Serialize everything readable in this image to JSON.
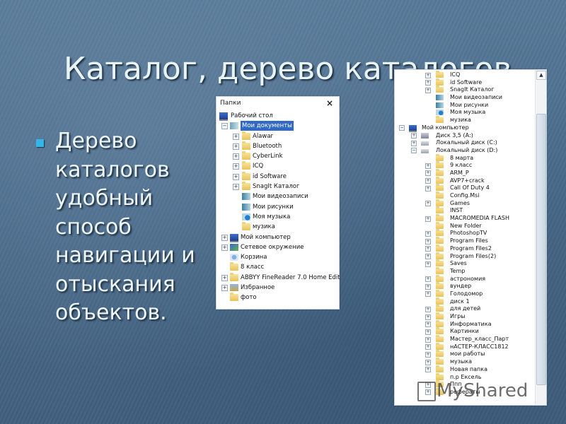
{
  "slide": {
    "title": "Каталог, дерево каталогов",
    "bullet_lines": [
      "Дерево",
      "каталогов",
      "удобный",
      "способ",
      "навигации и",
      "отыскания",
      "объектов."
    ],
    "bullet_color": "#33b5e5"
  },
  "folders_panel": {
    "header": "Папки",
    "close_icon": "×",
    "items": [
      {
        "label": "Рабочий стол",
        "level": 0,
        "expander": "",
        "icon": "monitor-icon"
      },
      {
        "label": "Мои документы",
        "level": 1,
        "expander": "−",
        "icon": "documents-icon",
        "selected": true
      },
      {
        "label": "Alawar",
        "level": 2,
        "expander": "+",
        "icon": "folder-icon"
      },
      {
        "label": "Bluetooth",
        "level": 2,
        "expander": "+",
        "icon": "folder-icon"
      },
      {
        "label": "CyberLink",
        "level": 2,
        "expander": "+",
        "icon": "folder-icon"
      },
      {
        "label": "ICQ",
        "level": 2,
        "expander": "+",
        "icon": "folder-icon"
      },
      {
        "label": "id Software",
        "level": 2,
        "expander": "+",
        "icon": "folder-icon"
      },
      {
        "label": "SnagIt Каталог",
        "level": 2,
        "expander": "+",
        "icon": "folder-icon"
      },
      {
        "label": "Мои видеозаписи",
        "level": 2,
        "expander": "",
        "icon": "videos-icon"
      },
      {
        "label": "Мои рисунки",
        "level": 2,
        "expander": "",
        "icon": "pictures-icon"
      },
      {
        "label": "Моя музыка",
        "level": 2,
        "expander": "",
        "icon": "music-icon"
      },
      {
        "label": "музика",
        "level": 2,
        "expander": "",
        "icon": "folder-icon"
      },
      {
        "label": "Мой компьютер",
        "level": 1,
        "expander": "+",
        "icon": "computer-icon"
      },
      {
        "label": "Сетевое окружение",
        "level": 1,
        "expander": "+",
        "icon": "network-icon"
      },
      {
        "label": "Корзина",
        "level": 1,
        "expander": "",
        "icon": "recycle-bin-icon"
      },
      {
        "label": "8 класс",
        "level": 1,
        "expander": "",
        "icon": "folder-icon"
      },
      {
        "label": "ABBYY FineReader 7.0 Home Edit",
        "level": 1,
        "expander": "+",
        "icon": "folder-icon"
      },
      {
        "label": "Избранное",
        "level": 1,
        "expander": "+",
        "icon": "favorites-icon"
      },
      {
        "label": "фото",
        "level": 1,
        "expander": "",
        "icon": "folder-icon"
      }
    ]
  },
  "tree_panel": {
    "scroll_up_icon": "▲",
    "items": [
      {
        "label": "ICQ",
        "level": 2,
        "expander": "+",
        "icon": "folder-icon"
      },
      {
        "label": "id Software",
        "level": 2,
        "expander": "+",
        "icon": "folder-icon"
      },
      {
        "label": "SnagIt Каталог",
        "level": 2,
        "expander": "+",
        "icon": "folder-icon"
      },
      {
        "label": "Мои видеозаписи",
        "level": 2,
        "expander": "",
        "icon": "videos-icon"
      },
      {
        "label": "Мои рисунки",
        "level": 2,
        "expander": "",
        "icon": "pictures-icon"
      },
      {
        "label": "Моя музыка",
        "level": 2,
        "expander": "",
        "icon": "music-icon"
      },
      {
        "label": "музика",
        "level": 2,
        "expander": "",
        "icon": "folder-icon"
      },
      {
        "label": "Мой компьютер",
        "level": 0,
        "expander": "−",
        "icon": "computer-icon"
      },
      {
        "label": "Диск 3,5 (A:)",
        "level": 1,
        "expander": "+",
        "icon": "floppy-icon"
      },
      {
        "label": "Локальный диск (C:)",
        "level": 1,
        "expander": "+",
        "icon": "drive-icon"
      },
      {
        "label": "Локальный диск (D:)",
        "level": 1,
        "expander": "−",
        "icon": "drive-icon"
      },
      {
        "label": "8 марта",
        "level": 2,
        "expander": "",
        "icon": "folder-icon"
      },
      {
        "label": "9 класс",
        "level": 2,
        "expander": "+",
        "icon": "folder-icon"
      },
      {
        "label": "ARM_P",
        "level": 2,
        "expander": "+",
        "icon": "folder-icon"
      },
      {
        "label": "AVP7+crack",
        "level": 2,
        "expander": "+",
        "icon": "folder-icon"
      },
      {
        "label": "Call Of Duty 4",
        "level": 2,
        "expander": "+",
        "icon": "folder-icon"
      },
      {
        "label": "Config.Msi",
        "level": 2,
        "expander": "",
        "icon": "folder-icon"
      },
      {
        "label": "Games",
        "level": 2,
        "expander": "+",
        "icon": "folder-icon"
      },
      {
        "label": "INST",
        "level": 2,
        "expander": "",
        "icon": "folder-icon"
      },
      {
        "label": "MACROMEDIA FLASH",
        "level": 2,
        "expander": "+",
        "icon": "folder-icon"
      },
      {
        "label": "New Folder",
        "level": 2,
        "expander": "",
        "icon": "folder-icon"
      },
      {
        "label": "PhotoshopTV",
        "level": 2,
        "expander": "+",
        "icon": "folder-icon"
      },
      {
        "label": "Program Files",
        "level": 2,
        "expander": "+",
        "icon": "folder-icon"
      },
      {
        "label": "Program Files2",
        "level": 2,
        "expander": "+",
        "icon": "folder-icon"
      },
      {
        "label": "Program Files(2)",
        "level": 2,
        "expander": "+",
        "icon": "folder-icon"
      },
      {
        "label": "Saves",
        "level": 2,
        "expander": "+",
        "icon": "folder-icon"
      },
      {
        "label": "Temp",
        "level": 2,
        "expander": "",
        "icon": "folder-icon"
      },
      {
        "label": "астрономия",
        "level": 2,
        "expander": "+",
        "icon": "folder-icon"
      },
      {
        "label": "вундер",
        "level": 2,
        "expander": "+",
        "icon": "folder-icon"
      },
      {
        "label": "Голодомор",
        "level": 2,
        "expander": "+",
        "icon": "folder-icon"
      },
      {
        "label": "диск 1",
        "level": 2,
        "expander": "",
        "icon": "folder-icon"
      },
      {
        "label": "для детей",
        "level": 2,
        "expander": "+",
        "icon": "folder-icon"
      },
      {
        "label": "Игры",
        "level": 2,
        "expander": "+",
        "icon": "folder-icon"
      },
      {
        "label": "Информатика",
        "level": 2,
        "expander": "+",
        "icon": "folder-icon"
      },
      {
        "label": "Картинки",
        "level": 2,
        "expander": "+",
        "icon": "folder-icon"
      },
      {
        "label": "Мастер_класс_Парт",
        "level": 2,
        "expander": "+",
        "icon": "folder-icon"
      },
      {
        "label": "нАСТЕР-КЛАСС1812",
        "level": 2,
        "expander": "+",
        "icon": "folder-icon"
      },
      {
        "label": "мои работы",
        "level": 2,
        "expander": "+",
        "icon": "folder-icon"
      },
      {
        "label": "музыка",
        "level": 2,
        "expander": "+",
        "icon": "folder-icon"
      },
      {
        "label": "Новая папка",
        "level": 2,
        "expander": "+",
        "icon": "folder-icon"
      },
      {
        "label": "п.р Ексель",
        "level": 2,
        "expander": "",
        "icon": "folder-icon"
      },
      {
        "label": "Ппп",
        "level": 2,
        "expander": "+",
        "icon": "folder-icon"
      },
      {
        "label": "рефераты",
        "level": 2,
        "expander": "+",
        "icon": "folder-icon"
      }
    ]
  },
  "watermark": {
    "text": "MyShared"
  }
}
